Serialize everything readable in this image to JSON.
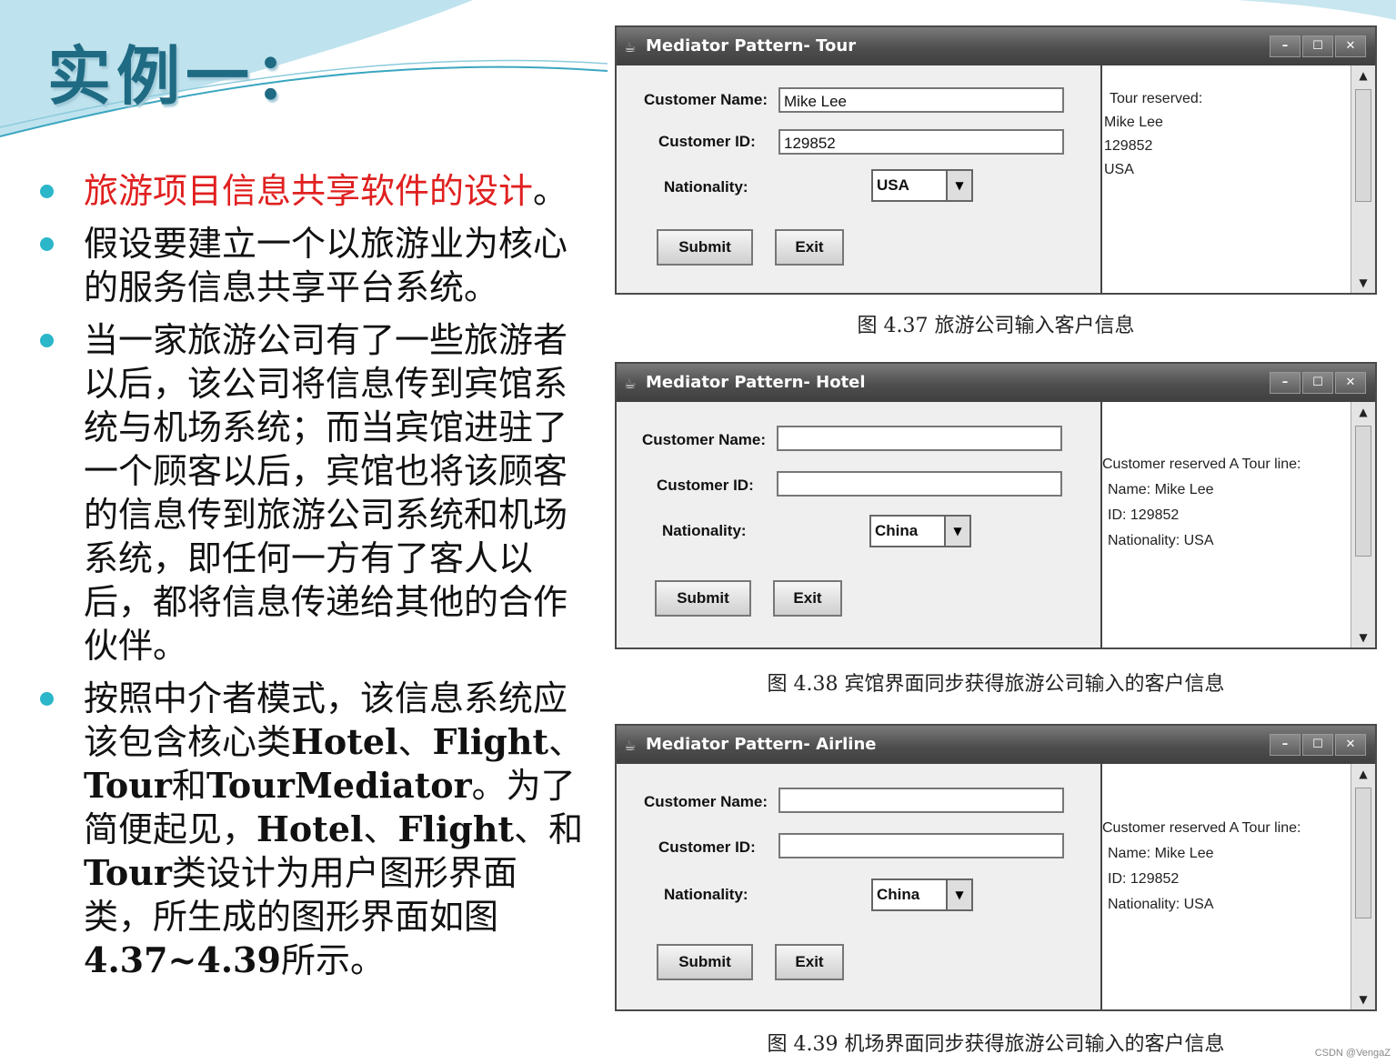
{
  "slide": {
    "title": "实例一：",
    "bullets": [
      {
        "text": "旅游项目信息共享软件的设计",
        "suffix": "。"
      },
      {
        "text": "假设要建立一个以旅游业为核心的服务信息共享平台系统。"
      },
      {
        "text": "当一家旅游公司有了一些旅游者以后，该公司将信息传到宾馆系统与机场系统；而当宾馆进驻了一个顾客以后，宾馆也将该顾客的信息传到旅游公司系统和机场系统，即任何一方有了客人以后，都将信息传递给其他的合作伙伴。"
      },
      {
        "parts": [
          "按照中介者模式，该信息系统应该包含核心类",
          "Hotel",
          "、",
          "Flight",
          "、",
          "Tour",
          "和",
          "TourMediator",
          "。为了简便起见，",
          "Hotel",
          "、",
          "Flight",
          "、和",
          "Tour",
          "类设计为用户图形界面类，所生成的图形界面如图",
          "4.37~4.39",
          "所示。"
        ]
      }
    ]
  },
  "windows": [
    {
      "title": "Mediator Pattern- Tour",
      "labels": {
        "name": "Customer Name:",
        "id": "Customer ID:",
        "nationality": "Nationality:"
      },
      "name_value": "Mike Lee",
      "id_value": "129852",
      "nationality_value": "USA",
      "submit": "Submit",
      "exit": "Exit",
      "output": [
        "Tour reserved:",
        "Mike Lee",
        "129852",
        "USA"
      ],
      "caption": "图 4.37   旅游公司输入客户信息"
    },
    {
      "title": "Mediator Pattern- Hotel",
      "labels": {
        "name": "Customer Name:",
        "id": "Customer ID:",
        "nationality": "Nationality:"
      },
      "name_value": "",
      "id_value": "",
      "nationality_value": "China",
      "submit": "Submit",
      "exit": "Exit",
      "output": [
        "Customer reserved A Tour line:",
        "Name: Mike Lee",
        "ID: 129852",
        "Nationality: USA"
      ],
      "caption": "图 4.38   宾馆界面同步获得旅游公司输入的客户信息"
    },
    {
      "title": "Mediator Pattern- Airline",
      "labels": {
        "name": "Customer Name:",
        "id": "Customer ID:",
        "nationality": "Nationality:"
      },
      "name_value": "",
      "id_value": "",
      "nationality_value": "China",
      "submit": "Submit",
      "exit": "Exit",
      "output": [
        "Customer reserved A Tour line:",
        "Name: Mike Lee",
        "ID: 129852",
        "Nationality: USA"
      ],
      "caption": "图 4.39   机场界面同步获得旅游公司输入的客户信息"
    }
  ],
  "window_buttons": {
    "minimize": "–",
    "maximize": "☐",
    "close": "✕"
  },
  "watermark": "CSDN @VengaZ",
  "colors": {
    "title": "#1f6b83",
    "bullet": "#2bb6c9",
    "highlight": "#e02020"
  }
}
